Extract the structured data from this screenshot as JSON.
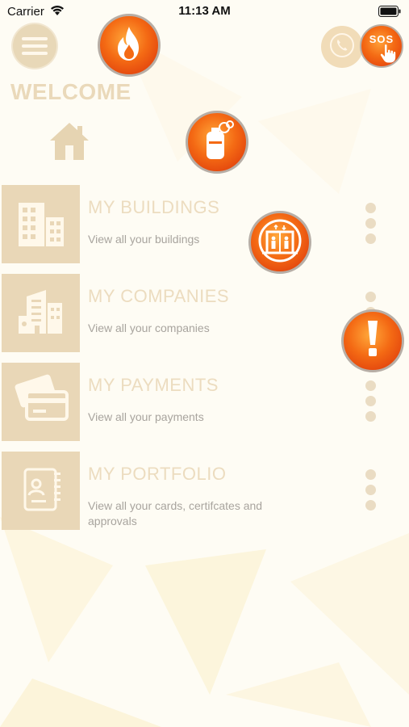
{
  "status_bar": {
    "carrier": "Carrier",
    "time": "11:13 AM",
    "wifi_icon": "wifi-icon",
    "battery_icon": "battery-icon"
  },
  "header": {
    "menu_icon": "hamburger-menu-icon",
    "call_icon": "phone-icon",
    "sos_label": "SOS"
  },
  "welcome": "WELCOME",
  "home_icon": "home-icon",
  "emergency_buttons": [
    {
      "name": "fire-emergency-button",
      "icon": "flame-icon"
    },
    {
      "name": "gas-leak-emergency-button",
      "icon": "gas-cylinder-icon"
    },
    {
      "name": "elevator-emergency-button",
      "icon": "elevator-icon"
    },
    {
      "name": "alert-emergency-button",
      "icon": "exclamation-icon"
    }
  ],
  "menu": [
    {
      "title": "MY BUILDINGS",
      "subtitle": "View all your buildings",
      "icon": "buildings-icon"
    },
    {
      "title": "MY COMPANIES",
      "subtitle": "View all your companies",
      "icon": "company-icon"
    },
    {
      "title": "MY PAYMENTS",
      "subtitle": "View all your payments",
      "icon": "payment-cards-icon"
    },
    {
      "title": "MY PORTFOLIO",
      "subtitle": "View all your cards, certifcates and approvals",
      "icon": "portfolio-icon"
    }
  ],
  "colors": {
    "accent_beige": "#e9d7b7",
    "emergency_orange": "#f46a14",
    "background": "#fefcf4"
  }
}
